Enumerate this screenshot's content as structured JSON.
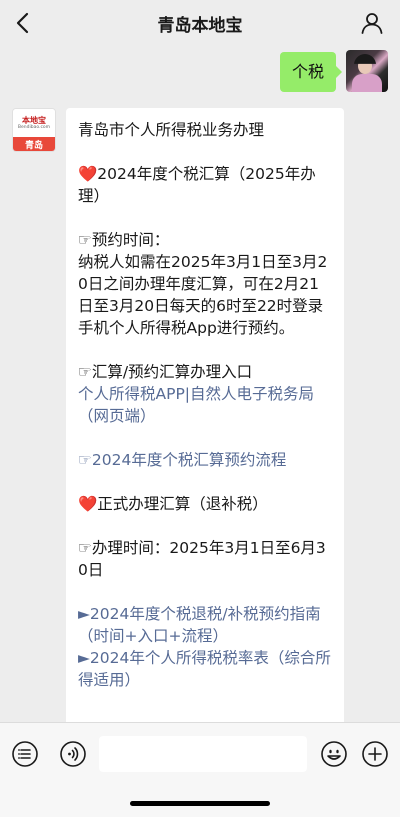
{
  "header": {
    "title": "青岛本地宝",
    "back_icon": "chevron-left-icon",
    "profile_icon": "person-icon"
  },
  "outgoing": {
    "text": "个税"
  },
  "incoming": {
    "avatar": {
      "brand": "本地宝",
      "url": "Bendibao.com",
      "city": "青岛"
    },
    "lines": [
      {
        "text": "青岛市个人所得税业务办理",
        "style": "normal"
      },
      {
        "text": "",
        "style": "gap"
      },
      {
        "text": "❤️2024年度个税汇算（2025年办理）",
        "style": "normal"
      },
      {
        "text": "",
        "style": "gap"
      },
      {
        "text": "☞预约时间：",
        "style": "normal"
      },
      {
        "text": "纳税人如需在2025年3月1日至3月20日之间办理年度汇算，可在2月21日至3月20日每天的6时至22时登录手机个人所得税App进行预约。",
        "style": "normal"
      },
      {
        "text": "",
        "style": "gap"
      },
      {
        "text": "☞汇算/预约汇算办理入口",
        "style": "normal"
      },
      {
        "text": "个人所得税APP|自然人电子税务局（网页端）",
        "style": "link"
      },
      {
        "text": "",
        "style": "gap"
      },
      {
        "text": "☞2024年度个税汇算预约流程",
        "style": "link"
      },
      {
        "text": "",
        "style": "gap"
      },
      {
        "text": "❤️正式办理汇算（退补税）",
        "style": "normal"
      },
      {
        "text": "",
        "style": "gap"
      },
      {
        "text": "☞办理时间：2025年3月1日至6月30日",
        "style": "normal"
      },
      {
        "text": "",
        "style": "gap"
      },
      {
        "text": "►2024年度个税退税/补税预约指南（时间+入口+流程）",
        "style": "link"
      },
      {
        "text": "►2024年个人所得税税率表（综合所得适用）",
        "style": "link"
      }
    ]
  },
  "bottom_bar": {
    "menu_icon": "menu-list-icon",
    "voice_icon": "voice-icon",
    "emoji_icon": "emoji-icon",
    "plus_icon": "plus-icon",
    "input_value": ""
  },
  "colors": {
    "background": "#ededed",
    "outgoing_bubble": "#95ec69",
    "incoming_bubble": "#ffffff",
    "link": "#576b95",
    "heart": "#e0242a"
  }
}
